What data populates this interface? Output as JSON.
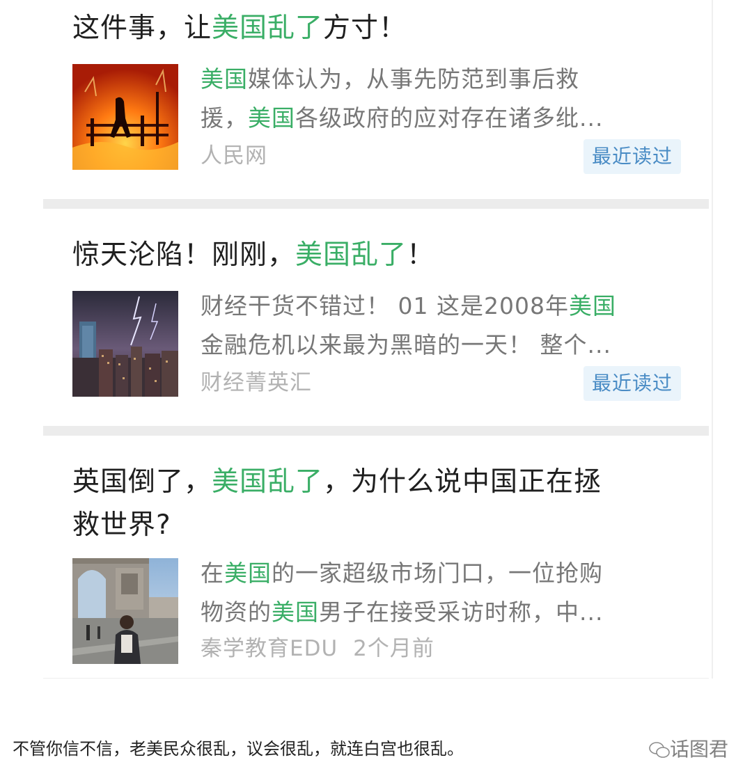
{
  "articles": [
    {
      "title": {
        "pre": "这件事，让",
        "hl": "美国乱了",
        "post": "方寸！"
      },
      "snippet": {
        "line1_hl": "美国",
        "line1_rest": "媒体认为，从事先防范到事后救",
        "line2_pre": "援，",
        "line2_hl": "美国",
        "line2_rest": "各级政府的应对存在诸多纰..."
      },
      "source": "人民网",
      "badge": "最近读过",
      "thumb_icon": "wildfire-photo"
    },
    {
      "title": {
        "pre": "惊天沦陷！刚刚，",
        "hl": "美国乱了",
        "post": "！"
      },
      "snippet": {
        "line1_pre": "财经干货不错过！ 01 这是2008年",
        "line1_hl": "美国",
        "line2": "金融危机以来最为黑暗的一天！ 整个..."
      },
      "source": "财经菁英汇",
      "badge": "最近读过",
      "thumb_icon": "city-lightning-photo"
    },
    {
      "title": {
        "pre": "英国倒了，",
        "hl": "美国乱了",
        "post": "，为什么说中国正在拯",
        "line2": "救世界?"
      },
      "snippet": {
        "line1_pre": "在",
        "line1_hl": "美国",
        "line1_rest": "的一家超级市场门口，一位抢购",
        "line2_pre": "物资的",
        "line2_hl": "美国",
        "line2_rest": "男子在接受采访时称，中..."
      },
      "source": "秦学教育EDU",
      "time": "2个月前",
      "thumb_icon": "arc-de-triomphe-photo"
    }
  ],
  "caption": "不管你信不信，老美民众很乱，议会很乱，就连白宫也很乱。",
  "watermark": "话图君",
  "colors": {
    "highlight": "#3aae66",
    "title": "#1f1f1f",
    "snippet": "#777777",
    "meta": "#b2b2b2",
    "badge_bg": "#eaf4fb",
    "badge_text": "#4a8cc5"
  }
}
